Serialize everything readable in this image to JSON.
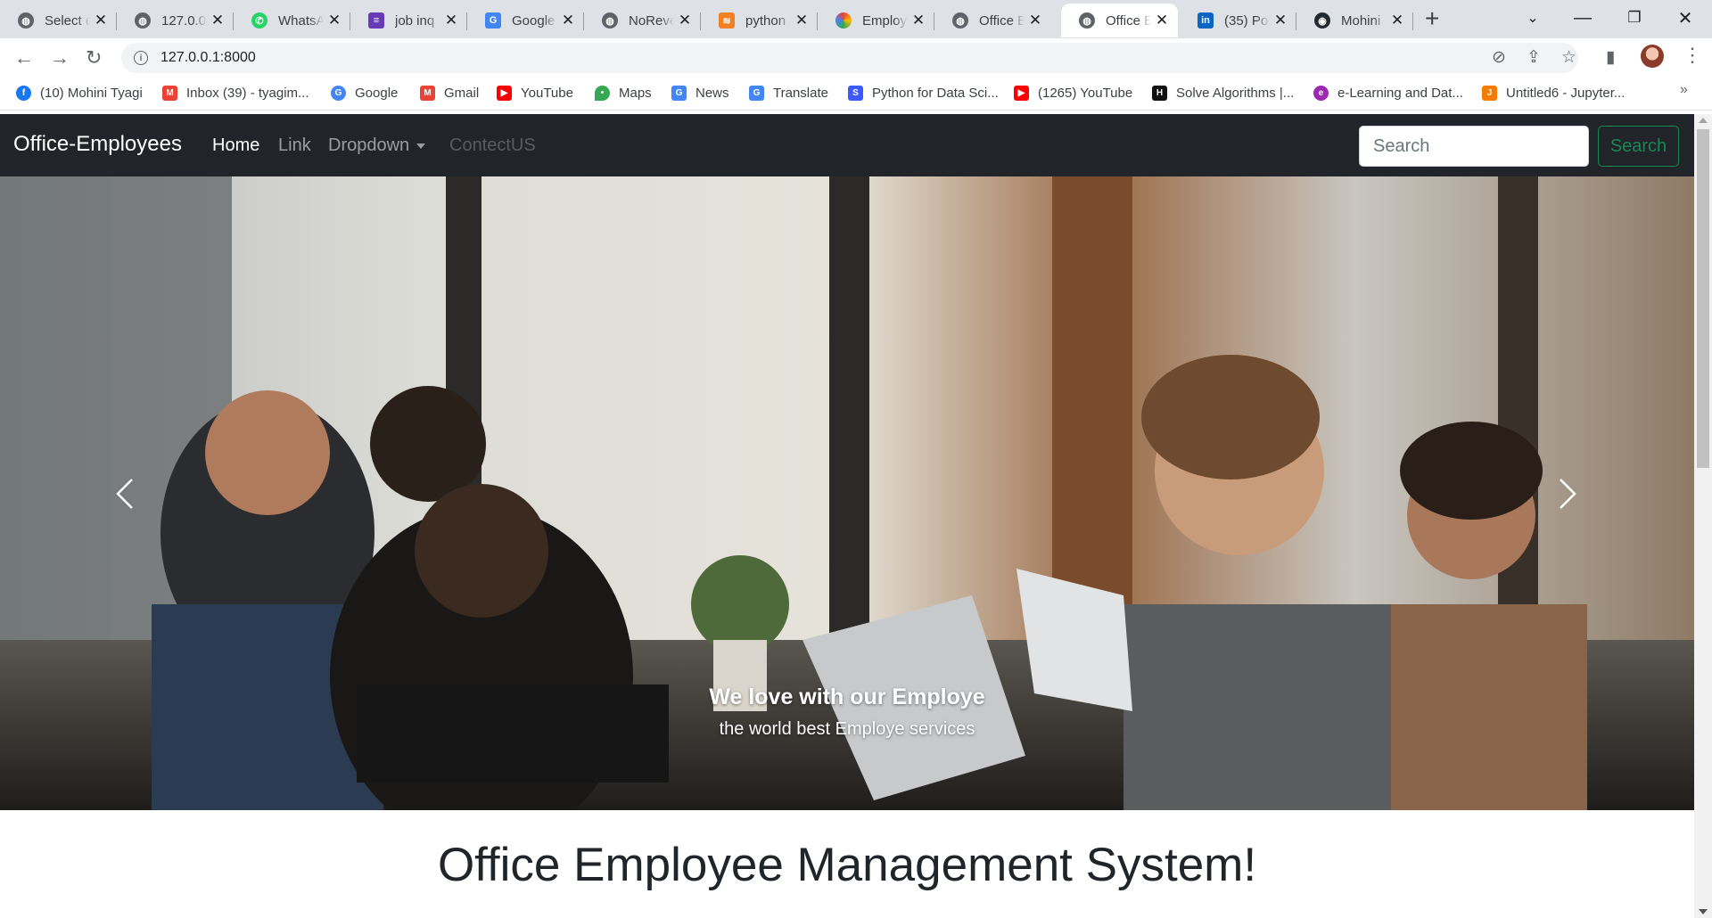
{
  "browser": {
    "tabs": [
      {
        "title": "Select e",
        "favicon": "globe-icon"
      },
      {
        "title": "127.0.0.",
        "favicon": "globe-icon"
      },
      {
        "title": "WhatsA",
        "favicon": "whatsapp-icon"
      },
      {
        "title": "job inq",
        "favicon": "forms-icon"
      },
      {
        "title": "Google",
        "favicon": "google-translate-icon"
      },
      {
        "title": "NoReve",
        "favicon": "globe-icon"
      },
      {
        "title": "python",
        "favicon": "stackoverflow-icon"
      },
      {
        "title": "Employ",
        "favicon": "colab-icon"
      },
      {
        "title": "Office E",
        "favicon": "globe-icon"
      },
      {
        "title": "Office E",
        "favicon": "globe-icon"
      },
      {
        "title": "(35) Po:",
        "favicon": "linkedin-icon"
      },
      {
        "title": "Mohini",
        "favicon": "github-icon"
      }
    ],
    "active_tab_index": 9,
    "url": "127.0.0.1:8000",
    "bookmarks": [
      {
        "label": "(10) Mohini Tyagi",
        "icon": "facebook-icon"
      },
      {
        "label": "Inbox (39) - tyagim...",
        "icon": "gmail-icon"
      },
      {
        "label": "Google",
        "icon": "google-icon"
      },
      {
        "label": "Gmail",
        "icon": "gmail-icon"
      },
      {
        "label": "YouTube",
        "icon": "youtube-icon"
      },
      {
        "label": "Maps",
        "icon": "maps-icon"
      },
      {
        "label": "News",
        "icon": "news-icon"
      },
      {
        "label": "Translate",
        "icon": "translate-icon"
      },
      {
        "label": "Python for Data Sci...",
        "icon": "s-icon"
      },
      {
        "label": "(1265) YouTube",
        "icon": "youtube-icon"
      },
      {
        "label": "Solve Algorithms |...",
        "icon": "hackerrank-icon"
      },
      {
        "label": "e-Learning and Dat...",
        "icon": "elearning-icon"
      },
      {
        "label": "Untitled6 - Jupyter...",
        "icon": "jupyter-icon"
      }
    ]
  },
  "site": {
    "brand": "Office-Employees",
    "nav": {
      "home": "Home",
      "link": "Link",
      "dropdown": "Dropdown",
      "contact": "ContectUS"
    },
    "search": {
      "placeholder": "Search",
      "button": "Search"
    },
    "carousel": {
      "caption_title": "We love with our Employe",
      "caption_text": "the world best Employe services"
    },
    "heading": "Office Employee Management System!"
  }
}
